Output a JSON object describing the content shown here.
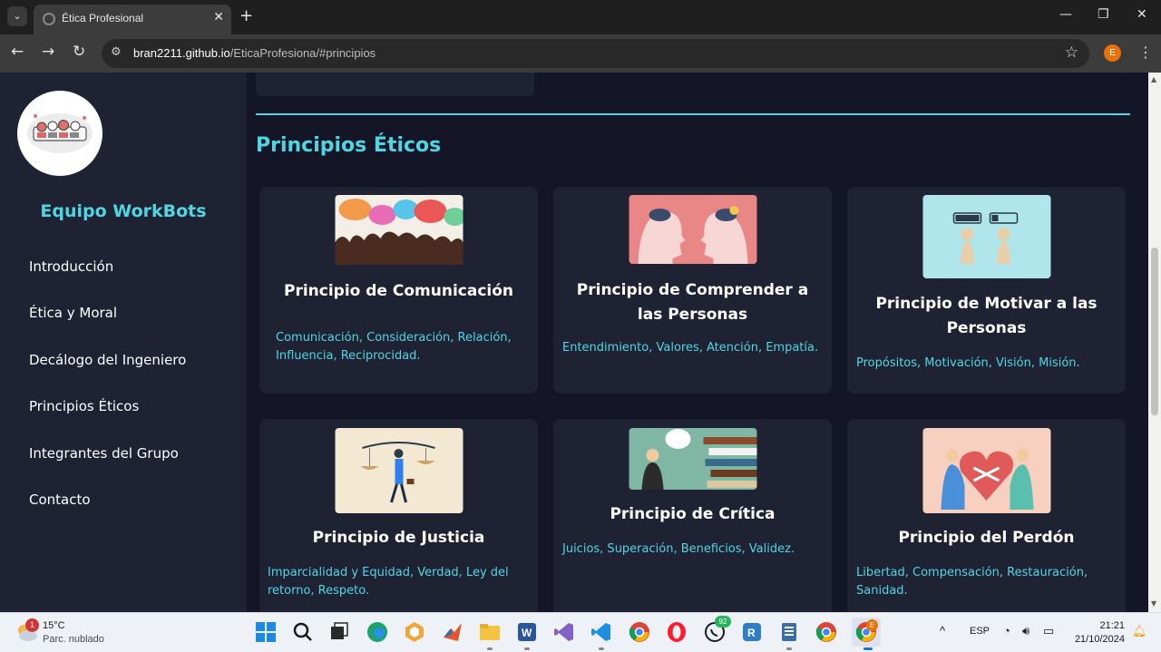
{
  "browser": {
    "tab_title": "Ética Profesional",
    "url_host": "bran2211.github.io",
    "url_path": "/EticaProfesiona/#principios",
    "profile_initial": "E"
  },
  "sidebar": {
    "brand": "Equipo WorkBots",
    "items": [
      {
        "label": "Introducción"
      },
      {
        "label": "Ética y Moral"
      },
      {
        "label": "Decálogo del Ingeniero"
      },
      {
        "label": "Principios Éticos"
      },
      {
        "label": "Integrantes del Grupo"
      },
      {
        "label": "Contacto"
      }
    ]
  },
  "main": {
    "section_title": "Principios Éticos",
    "cards": [
      {
        "title": "Principio de Comunicación",
        "text": "Comunicación, Consideración, Relación, Influencia, Reciprocidad."
      },
      {
        "title": "Principio de Comprender a las Personas",
        "text": "Entendimiento, Valores, Atención, Empatía."
      },
      {
        "title": "Principio de Motivar a las Personas",
        "text": "Propósitos, Motivación, Visión, Misión."
      },
      {
        "title": "Principio de Justicia",
        "text": "Imparcialidad y Equidad, Verdad, Ley del retorno, Respeto."
      },
      {
        "title": "Principio de Crítica",
        "text": "Juicios, Superación, Beneficios, Validez."
      },
      {
        "title": "Principio del Perdón",
        "text": "Libertad, Compensación, Restauración, Sanidad."
      }
    ]
  },
  "taskbar": {
    "weather_badge": "1",
    "temperature": "15°C",
    "condition": "Parc. nublado",
    "whatsapp_badge": "92",
    "chrome_badge": "E",
    "language": "ESP",
    "time": "21:21",
    "date": "21/10/2024"
  },
  "colors": {
    "accent": "#4fd6e3",
    "page_bg": "#141628",
    "card_bg": "#1f2233"
  }
}
